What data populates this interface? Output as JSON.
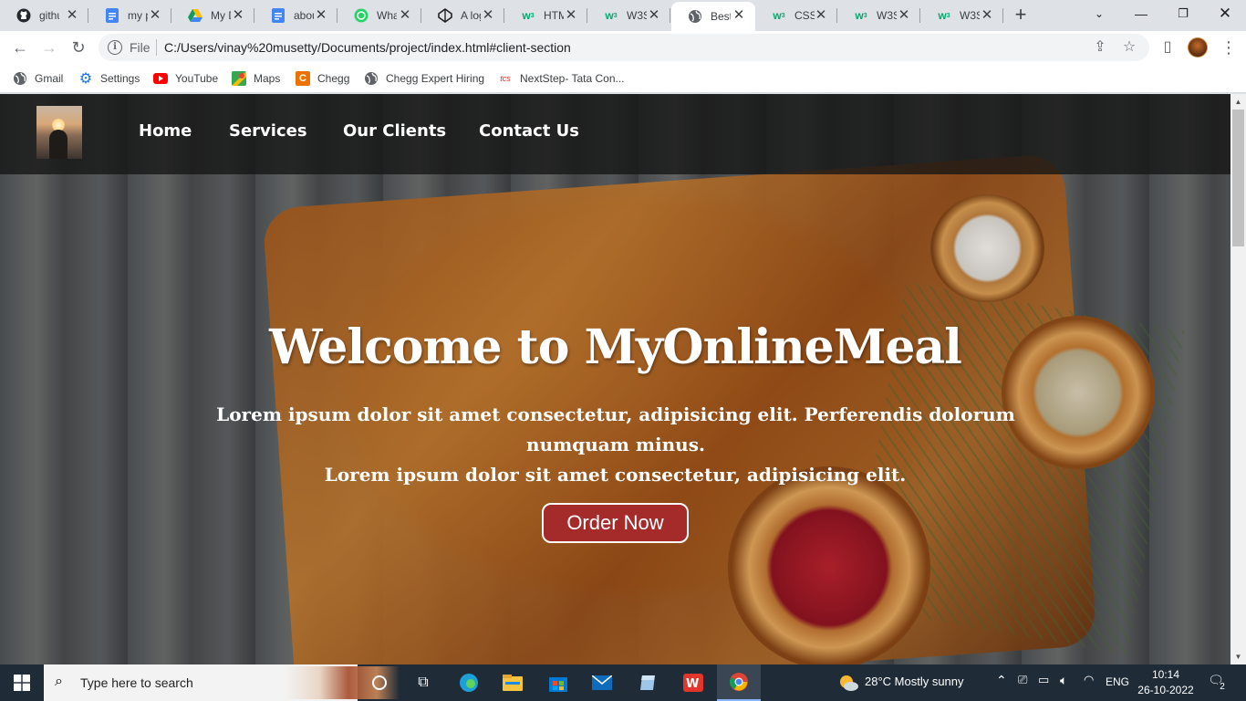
{
  "browser": {
    "tabs": [
      {
        "title": "github",
        "icon": "github-icon"
      },
      {
        "title": "my p",
        "icon": "docs-icon"
      },
      {
        "title": "My D",
        "icon": "drive-icon"
      },
      {
        "title": "abou",
        "icon": "docs-icon"
      },
      {
        "title": "What",
        "icon": "whatsapp-icon"
      },
      {
        "title": "A log",
        "icon": "codepen-icon"
      },
      {
        "title": "HTM",
        "icon": "w3schools-icon"
      },
      {
        "title": "W3S",
        "icon": "w3schools-icon"
      },
      {
        "title": "Best",
        "icon": "globe-icon",
        "active": true
      },
      {
        "title": "CSS",
        "icon": "w3schools-icon"
      },
      {
        "title": "W3S",
        "icon": "w3schools-icon"
      },
      {
        "title": "W3S",
        "icon": "w3schools-icon"
      }
    ],
    "url_scheme_label": "File",
    "url": "C:/Users/vinay%20musetty/Documents/project/index.html#client-section",
    "bookmarks": [
      {
        "label": "Gmail",
        "icon": "globe-icon"
      },
      {
        "label": "Settings",
        "icon": "gear-icon"
      },
      {
        "label": "YouTube",
        "icon": "youtube-icon"
      },
      {
        "label": "Maps",
        "icon": "maps-icon"
      },
      {
        "label": "Chegg",
        "icon": "chegg-icon"
      },
      {
        "label": "Chegg Expert Hiring",
        "icon": "globe-icon"
      },
      {
        "label": "NextStep- Tata Con...",
        "icon": "tcs-icon"
      }
    ]
  },
  "site": {
    "nav": [
      "Home",
      "Services",
      "Our Clients",
      "Contact Us"
    ],
    "hero": {
      "title": "Welcome to MyOnlineMeal",
      "description": "Lorem ipsum dolor sit amet consectetur, adipisicing elit. Perferendis dolorum numquam minus.",
      "description2": "Lorem ipsum dolor sit amet consectetur, adipisicing elit.",
      "cta": "Order Now"
    }
  },
  "taskbar": {
    "search_placeholder": "Type here to search",
    "weather": "28°C  Mostly sunny",
    "language": "ENG",
    "time": "10:14",
    "date": "26-10-2022",
    "notifications": "2"
  },
  "colors": {
    "cta_background": "#a52a2a",
    "taskbar": "#1f2b37",
    "tabstrip": "#dee1e6"
  }
}
